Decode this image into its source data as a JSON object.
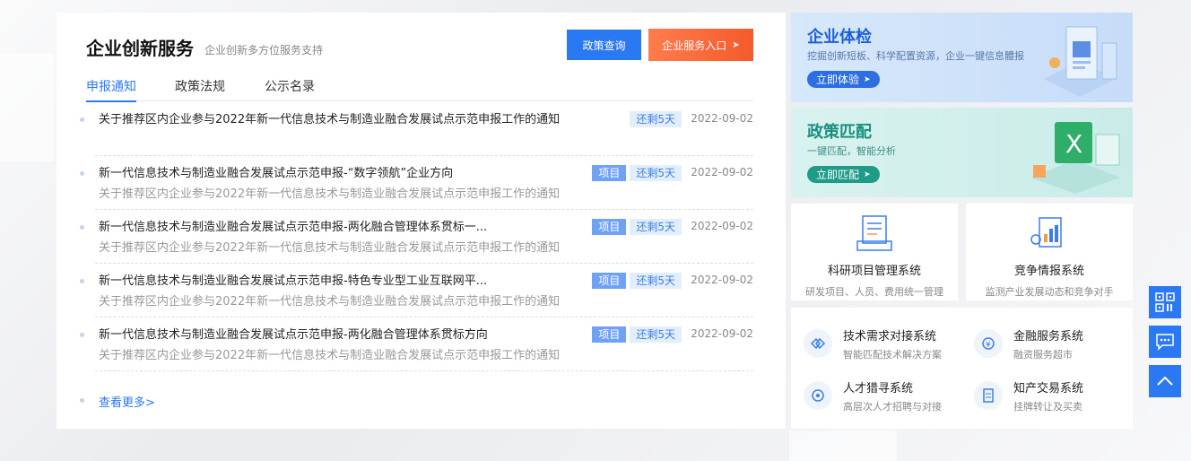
{
  "main": {
    "title": "企业创新服务",
    "subtitle": "企业创新多方位服务支持",
    "btn_policy": "政策查询",
    "btn_enter": "企业服务入口",
    "tabs": [
      {
        "label": "申报通知",
        "active": true
      },
      {
        "label": "政策法规",
        "active": false
      },
      {
        "label": "公示名录",
        "active": false
      }
    ],
    "items": [
      {
        "title": "关于推荐区内企业参与2022年新一代信息技术与制造业融合发展试点示范申报工作的通知",
        "subtitle": "",
        "tag": "",
        "days": "还剩5天",
        "date": "2022-09-02"
      },
      {
        "title": "新一代信息技术与制造业融合发展试点示范申报-“数字领航”企业方向",
        "subtitle": "关于推荐区内企业参与2022年新一代信息技术与制造业融合发展试点示范申报工作的通知",
        "tag": "项目",
        "days": "还剩5天",
        "date": "2022-09-02"
      },
      {
        "title": "新一代信息技术与制造业融合发展试点示范申报-两化融合管理体系贯标一...",
        "subtitle": "关于推荐区内企业参与2022年新一代信息技术与制造业融合发展试点示范申报工作的通知",
        "tag": "项目",
        "days": "还剩5天",
        "date": "2022-09-02"
      },
      {
        "title": "新一代信息技术与制造业融合发展试点示范申报-特色专业型工业互联网平...",
        "subtitle": "关于推荐区内企业参与2022年新一代信息技术与制造业融合发展试点示范申报工作的通知",
        "tag": "项目",
        "days": "还剩5天",
        "date": "2022-09-02"
      },
      {
        "title": "新一代信息技术与制造业融合发展试点示范申报-两化融合管理体系贯标方向",
        "subtitle": "关于推荐区内企业参与2022年新一代信息技术与制造业融合发展试点示范申报工作的通知",
        "tag": "项目",
        "days": "还剩5天",
        "date": "2022-09-02"
      }
    ],
    "more": "查看更多>"
  },
  "side": {
    "check": {
      "title": "企业体检",
      "desc": "挖掘创新短板、科学配置资源，企业一键信息體报",
      "btn": "立即体验"
    },
    "match": {
      "title": "政策匹配",
      "desc": "一键匹配，智能分析",
      "btn": "立即匹配"
    },
    "sys_cards": [
      {
        "name": "科研项目管理系统",
        "desc": "研发项目、人员、费用统一管理",
        "icon": "document-icon"
      },
      {
        "name": "竞争情报系统",
        "desc": "监测产业发展动态和竞争对手",
        "icon": "report-icon"
      }
    ],
    "sys_list": [
      {
        "name": "技术需求对接系统",
        "desc": "智能匹配技术解决方案",
        "icon": "connect-icon"
      },
      {
        "name": "金融服务系统",
        "desc": "融资服务超市",
        "icon": "finance-icon"
      },
      {
        "name": "人才猎寻系统",
        "desc": "高层次人才招聘与对接",
        "icon": "talent-icon"
      },
      {
        "name": "知产交易系统",
        "desc": "挂牌转让及买卖",
        "icon": "ip-icon"
      }
    ]
  },
  "float": {
    "qrcode_icon": "qrcode-icon",
    "chat_icon": "chat-icon",
    "top_icon": "back-to-top-icon"
  },
  "colors": {
    "primary": "#2b79f2",
    "orange": "#f55a2a",
    "teal": "#1f9b89"
  }
}
